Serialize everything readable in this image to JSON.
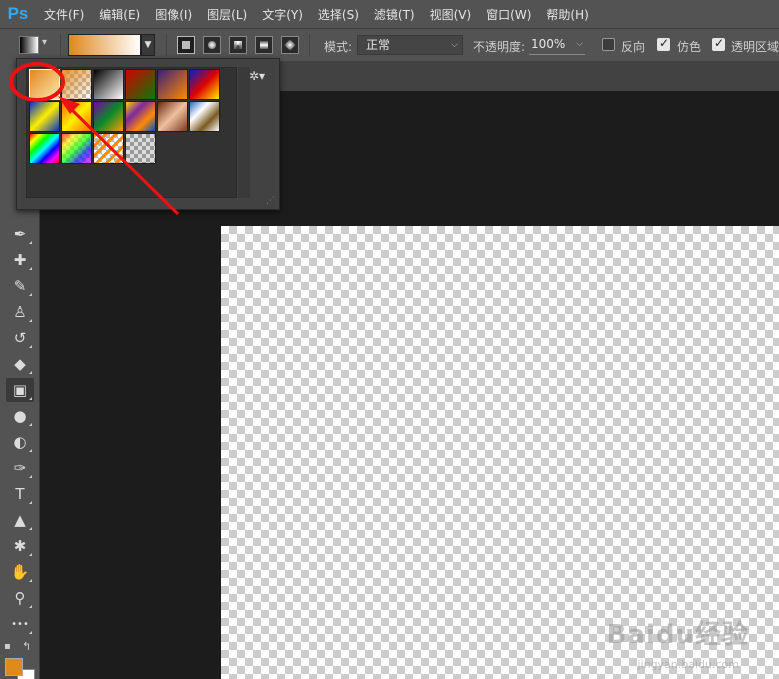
{
  "app": {
    "logo": "Ps"
  },
  "menu": [
    "文件(F)",
    "编辑(E)",
    "图像(I)",
    "图层(L)",
    "文字(Y)",
    "选择(S)",
    "滤镜(T)",
    "视图(V)",
    "窗口(W)",
    "帮助(H)"
  ],
  "options": {
    "mode_label": "模式:",
    "mode_value": "正常",
    "opacity_label": "不透明度:",
    "opacity_value": "100%",
    "reverse_label": "反向",
    "reverse_checked": false,
    "dither_label": "仿色",
    "dither_checked": true,
    "transparency_label": "透明区域",
    "transparency_checked": true,
    "gradient_start_color": "#e0881c",
    "gradient_end_color": "#ffffff"
  },
  "gradient_presets": [
    {
      "name": "foreground-to-background",
      "selected": true
    },
    {
      "name": "foreground-to-transparent"
    },
    {
      "name": "black-white"
    },
    {
      "name": "red-green"
    },
    {
      "name": "violet-orange"
    },
    {
      "name": "blue-red-yellow"
    },
    {
      "name": "blue-yellow-blue"
    },
    {
      "name": "orange-yellow-orange"
    },
    {
      "name": "violet-green-orange"
    },
    {
      "name": "yellow-violet-orange-blue"
    },
    {
      "name": "copper"
    },
    {
      "name": "chrome"
    },
    {
      "name": "spectrum"
    },
    {
      "name": "transparent-rainbow"
    },
    {
      "name": "transparent-stripes"
    },
    {
      "name": "neutral-density"
    }
  ],
  "toolbar": {
    "foreground_color": "#e08a1c",
    "background_color": "#ffffff",
    "tools": [
      {
        "name": "eyedropper-icon",
        "glyph": "✒"
      },
      {
        "name": "healing-brush-icon",
        "glyph": "✚"
      },
      {
        "name": "brush-icon",
        "glyph": "✎"
      },
      {
        "name": "clone-stamp-icon",
        "glyph": "♙"
      },
      {
        "name": "history-brush-icon",
        "glyph": "↺"
      },
      {
        "name": "eraser-icon",
        "glyph": "◆"
      },
      {
        "name": "gradient-icon",
        "glyph": "▣"
      },
      {
        "name": "blur-icon",
        "glyph": "●"
      },
      {
        "name": "dodge-icon",
        "glyph": "◐"
      },
      {
        "name": "pen-icon",
        "glyph": "✑"
      },
      {
        "name": "type-icon",
        "glyph": "T"
      },
      {
        "name": "path-selection-icon",
        "glyph": "▲"
      },
      {
        "name": "custom-shape-icon",
        "glyph": "✱"
      },
      {
        "name": "hand-icon",
        "glyph": "✋"
      },
      {
        "name": "zoom-icon",
        "glyph": "⚲"
      },
      {
        "name": "more-tools-icon",
        "glyph": "•••"
      }
    ]
  },
  "watermark": {
    "text": "Baidu经验",
    "sub": "jingyan.baidu.com"
  },
  "colors": {
    "annotation": "#ee1111"
  }
}
